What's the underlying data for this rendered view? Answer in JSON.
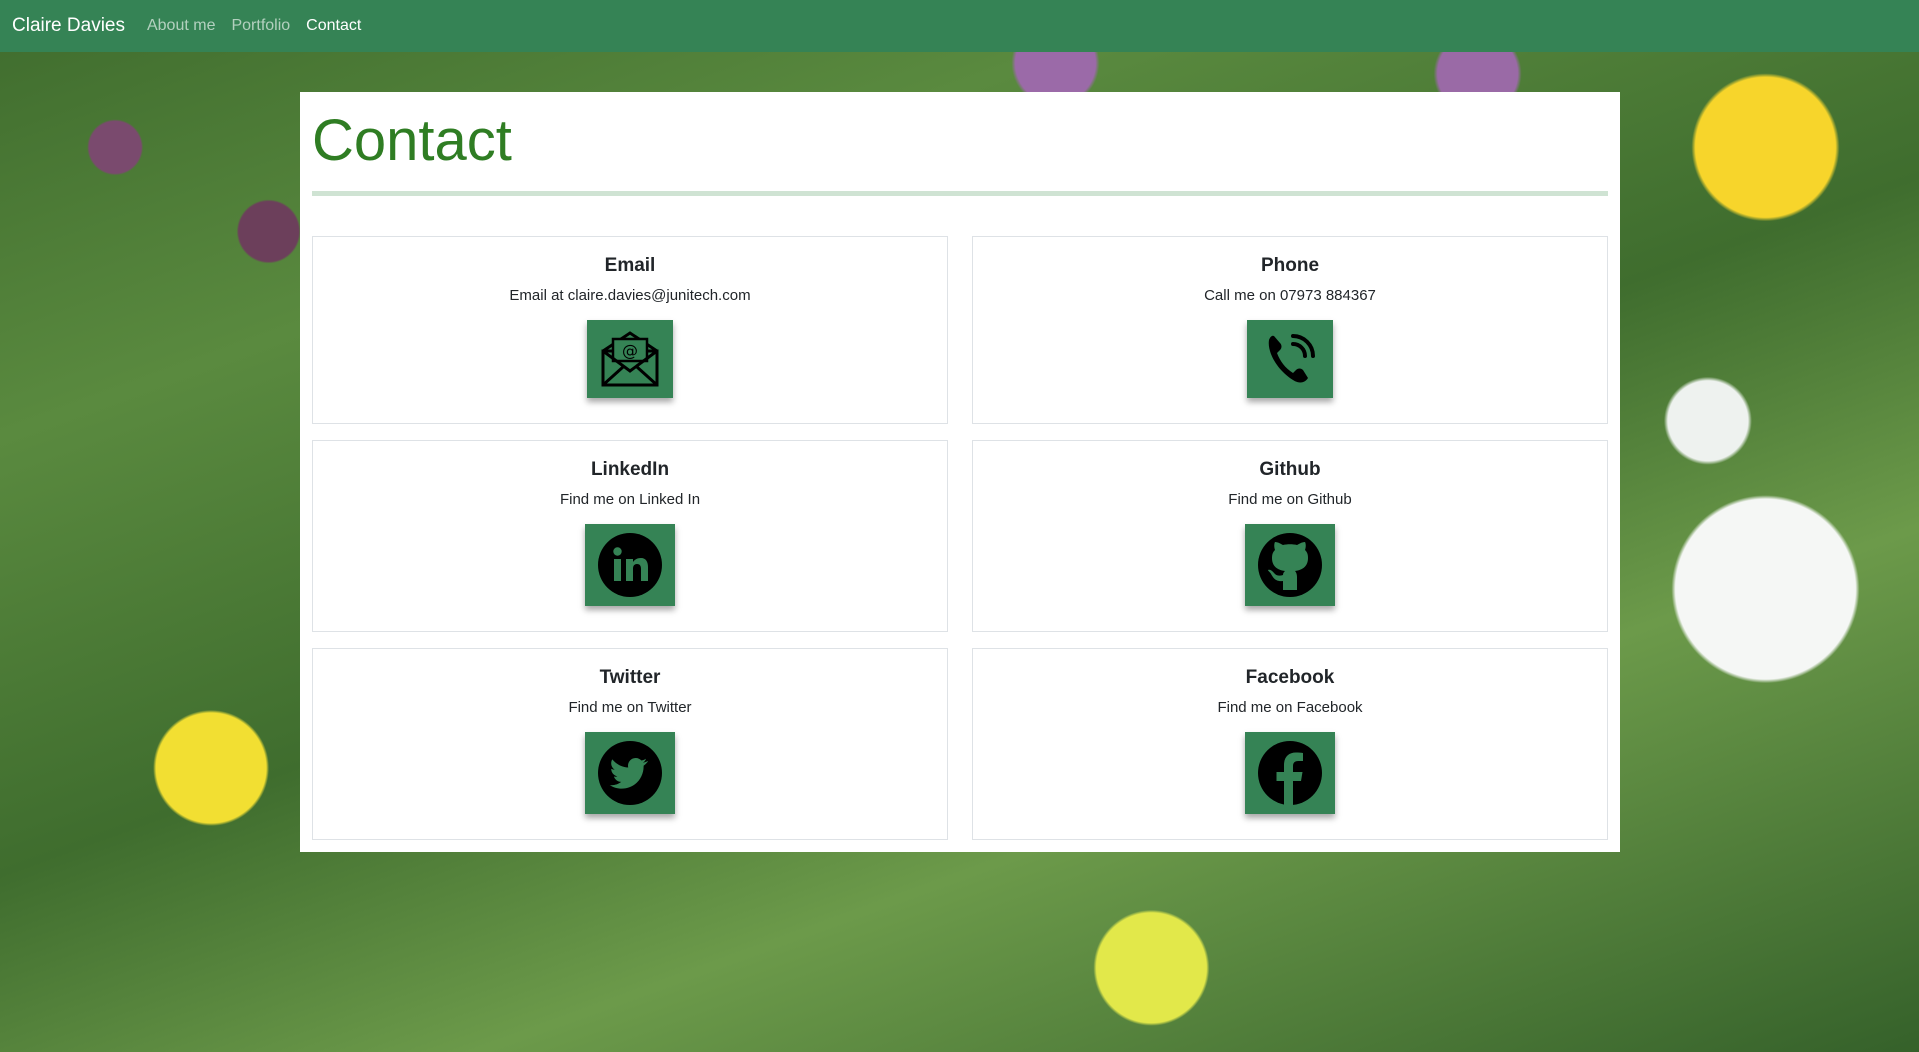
{
  "nav": {
    "brand": "Claire Davies",
    "links": [
      "About me",
      "Portfolio",
      "Contact"
    ]
  },
  "page": {
    "title": "Contact"
  },
  "cards": [
    {
      "title": "Email",
      "text": "Email at claire.davies@junitech.com",
      "icon": "envelope-icon"
    },
    {
      "title": "Phone",
      "text": "Call me on 07973 884367",
      "icon": "phone-icon"
    },
    {
      "title": "LinkedIn",
      "text": "Find me on Linked In",
      "icon": "linkedin-icon"
    },
    {
      "title": "Github",
      "text": "Find me on Github",
      "icon": "github-icon"
    },
    {
      "title": "Twitter",
      "text": "Find me on Twitter",
      "icon": "twitter-icon"
    },
    {
      "title": "Facebook",
      "text": "Find me on Facebook",
      "icon": "facebook-icon"
    }
  ],
  "colors": {
    "nav_bg": "#358355",
    "title": "#2f7d23",
    "icon_tile": "#358355"
  }
}
